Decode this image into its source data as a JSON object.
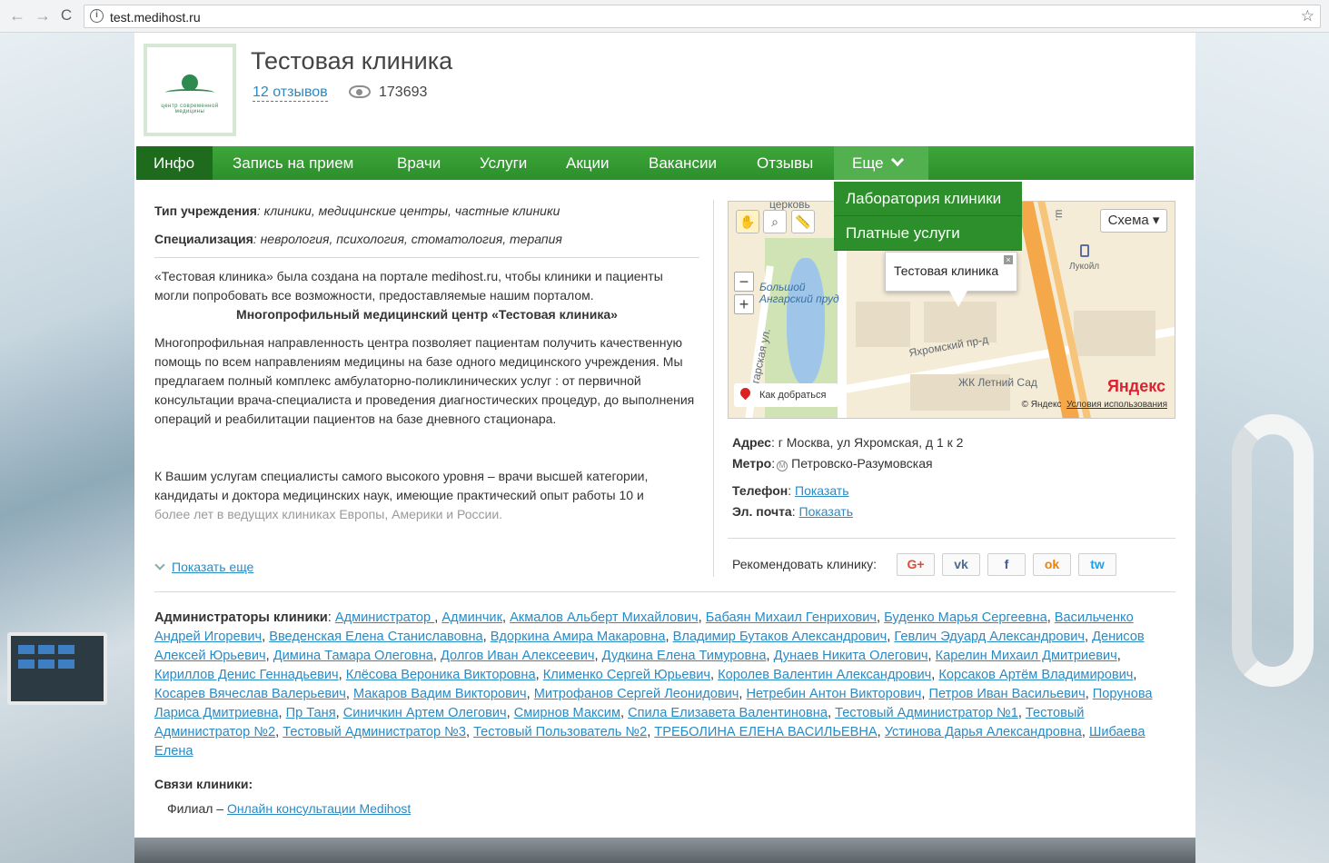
{
  "browser": {
    "url": "test.medihost.ru",
    "back_icon": "←",
    "forward_icon": "→",
    "reload_icon": "C",
    "star_icon": "☆"
  },
  "header": {
    "logo_text": "центр современной медицины",
    "title": "Тестовая клиника",
    "reviews": "12 отзывов",
    "views": "173693"
  },
  "nav": {
    "items": [
      "Инфо",
      "Запись на прием",
      "Врачи",
      "Услуги",
      "Акции",
      "Вакансии",
      "Отзывы",
      "Еще"
    ],
    "dropdown": [
      "Лаборатория клиники",
      "Платные услуги"
    ]
  },
  "info": {
    "type_label": "Тип учреждения",
    "type_value": ": клиники, медицинские центры, частные клиники",
    "spec_label": "Специализация",
    "spec_value": ": неврология, психология, стоматология, терапия"
  },
  "description": {
    "p1": "«Тестовая клиника» была создана на портале medihost.ru, чтобы клиники и пациенты могли попробовать все возможности, предоставляемые нашим порталом.",
    "heading": "Многопрофильный медицинский центр «Тестовая клиника»",
    "p2": "Многопрофильная направленность центра позволяет пациентам получить качественную помощь по всем направлениям  медицины  на базе одного медицинского учреждения.  Мы предлагаем полный  комплекс амбулаторно-поликлинических услуг : от первичной консультации врача-специалиста и проведения диагностических процедур,  до выполнения операций и реабилитации пациентов на базе дневного стационара.",
    "p3a": "К Вашим услугам специалисты самого высокого уровня – врачи высшей категории, кандидаты и доктора медицинских наук, имеющие практический опыт работы 10 и",
    "p3b": "более лет в ведущих клиниках Европы, Америки и России.",
    "show_more": "Показать еще"
  },
  "map": {
    "scheme": "Схема ▾",
    "balloon": "Тестовая клиника",
    "route": "Как добраться",
    "yandex": "Яндекс",
    "copyright": "© Яндекс",
    "terms": "Условия использования",
    "label_pond": "Большой Ангарский пруд",
    "label_street1": "Ангарская ул.",
    "label_street2": "Яхромский пр-д",
    "label_block": "ЖК Летний Сад",
    "label_fuel": "Лукойл",
    "label_top": "церковь",
    "label_hwy": "ш."
  },
  "contacts": {
    "address_label": "Адрес",
    "address_value": ": г Москва, ул Яхромская, д 1 к 2",
    "metro_label": "Метро",
    "metro_value": "Петровско-Разумовская",
    "phone_label": "Телефон",
    "phone_link": "Показать",
    "email_label": "Эл. почта",
    "email_link": "Показать"
  },
  "recommend": {
    "label": "Рекомендовать клинику:",
    "buttons": [
      "G+",
      "vk",
      "f",
      "ok",
      "tw"
    ],
    "colors": {
      "google": "#dd4b39",
      "vk": "#4c6c91",
      "facebook": "#3b5998",
      "ok": "#ee8208",
      "twitter": "#1da1f2"
    }
  },
  "admins": {
    "label": "Администраторы клиники",
    "names": [
      "Администратор ",
      "Админчик",
      "Акмалов Альберт Михайлович",
      "Бабаян Михаил Генрихович",
      "Буденко Марья Сергеевна",
      "Васильченко Андрей Игоревич",
      "Введенская Елена Станиславовна",
      "Вдоркина Амира Макаровна",
      "Владимир Бутаков Александрович",
      "Гевлич Эдуард Александрович",
      "Денисов Алексей Юрьевич",
      "Димина Тамара Олеговна",
      "Долгов Иван Алексеевич",
      "Дудкина Елена Тимуровна",
      "Дунаев Никита Олегович",
      "Карелин Михаил Дмитриевич",
      "Кириллов Денис Геннадьевич",
      "Клёсова Вероника Викторовна",
      "Клименко Сергей Юрьевич",
      "Королев Валентин Александрович",
      "Корсаков Артём Владимирович",
      "Косарев Вячеслав Валерьевич",
      "Макаров Вадим Викторович",
      "Митрофанов Сергей Леонидович",
      "Нетребин Антон Викторович",
      "Петров Иван Васильевич",
      "Порунова Лариса Дмитриевна",
      "Пр Таня",
      "Синичкин Артем Олегович",
      "Смирнов Максим",
      "Спила Елизавета Валентиновна",
      "Тестовый Администратор №1",
      "Тестовый Администратор №2",
      "Тестовый Администратор №3",
      "Тестовый Пользователь №2",
      "ТРЕБОЛИНА ЕЛЕНА ВАСИЛЬЕВНА",
      "Устинова Дарья Александровна",
      "Шибаева Елена"
    ]
  },
  "relations": {
    "title": "Связи клиники:",
    "prefix": "Филиал – ",
    "link": "Онлайн консультации Medihost"
  }
}
